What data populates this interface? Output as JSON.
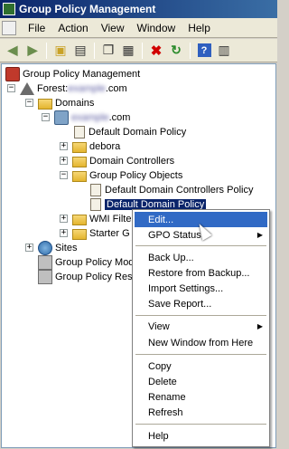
{
  "window": {
    "title": "Group Policy Management"
  },
  "menu": {
    "items": [
      "File",
      "Action",
      "View",
      "Window",
      "Help"
    ]
  },
  "toolbar": {
    "buttons": [
      "back-icon",
      "forward-icon",
      "up-folder-icon",
      "show-hide-tree-icon",
      "copy-icon",
      "paste-icon",
      "delete-icon",
      "refresh-icon",
      "help-icon",
      "properties-icon"
    ]
  },
  "tree": {
    "root": "Group Policy Management",
    "forest_prefix": "Forest: ",
    "forest_name": "example",
    "forest_suffix": ".com",
    "domains": "Domains",
    "domain_name": "example",
    "domain_suffix": ".com",
    "default_domain_policy_link": "Default Domain Policy",
    "debora": "debora",
    "domain_controllers": "Domain Controllers",
    "gpo": "Group Policy Objects",
    "gpo_ddcp": "Default Domain Controllers Policy",
    "gpo_ddp": "Default Domain Policy",
    "wmi": "WMI Filte",
    "starter": "Starter G",
    "sites": "Sites",
    "modeling": "Group Policy Mod",
    "results": "Group Policy Resu"
  },
  "context_menu": {
    "edit": "Edit...",
    "gpo_status": "GPO Status",
    "backup": "Back Up...",
    "restore": "Restore from Backup...",
    "import": "Import Settings...",
    "save_report": "Save Report...",
    "view": "View",
    "new_window": "New Window from Here",
    "copy": "Copy",
    "delete": "Delete",
    "rename": "Rename",
    "refresh": "Refresh",
    "help": "Help"
  }
}
